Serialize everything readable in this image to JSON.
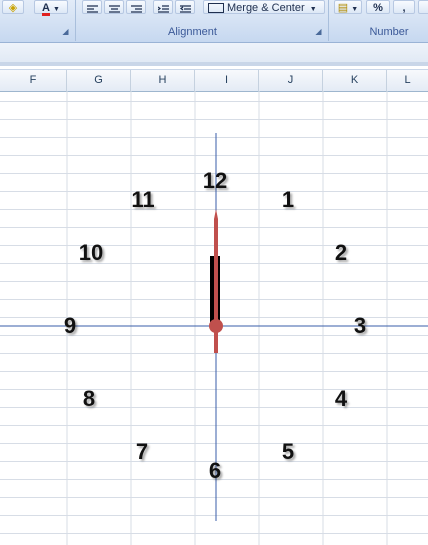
{
  "ribbon": {
    "merge_label": "Merge & Center",
    "alignment_label": "Alignment",
    "number_label": "Number",
    "percent_symbol": "%",
    "comma_symbol": ",",
    "font_color_letter": "A"
  },
  "columns": [
    "F",
    "G",
    "H",
    "I",
    "J",
    "K",
    "L"
  ],
  "clock": {
    "numbers": [
      "12",
      "1",
      "2",
      "3",
      "4",
      "5",
      "6",
      "7",
      "8",
      "9",
      "10",
      "11"
    ],
    "hand_color": "#c0504d",
    "hour_hand_color": "#000000",
    "axis_color": "#3a5da8"
  }
}
